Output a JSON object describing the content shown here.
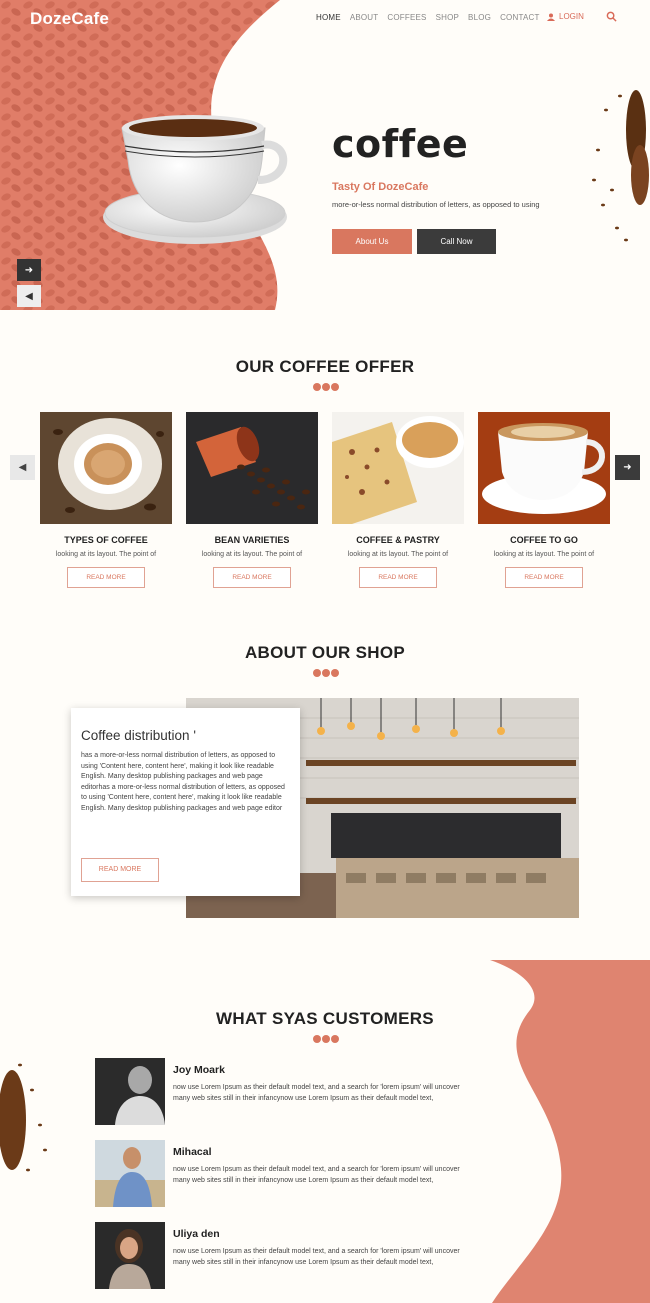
{
  "header": {
    "logo_part1": "Doze",
    "logo_part2": "Cafe",
    "nav": [
      "HOME",
      "ABOUT",
      "COFFEES",
      "SHOP",
      "BLOG",
      "CONTACT"
    ],
    "login_label": "LOGIN"
  },
  "hero": {
    "title": "coffee",
    "subtitle": "Tasty Of DozeCafe",
    "description": "more-or-less normal distribution of letters, as opposed to using",
    "about_button": "About Us",
    "call_button": "Call Now"
  },
  "offer": {
    "title": "OUR COFFEE OFFER",
    "items": [
      {
        "name": "TYPES OF COFFEE",
        "desc": "looking at its layout. The point of",
        "button": "READ MORE"
      },
      {
        "name": "BEAN VARIETIES",
        "desc": "looking at its layout. The point of",
        "button": "READ MORE"
      },
      {
        "name": "COFFEE & PASTRY",
        "desc": "looking at its layout. The point of",
        "button": "READ MORE"
      },
      {
        "name": "COFFEE TO GO",
        "desc": "looking at its layout. The point of",
        "button": "READ MORE"
      }
    ]
  },
  "about": {
    "title": "ABOUT OUR SHOP",
    "heading": "Coffee distribution '",
    "text": "has a more-or-less normal distribution of letters, as opposed to using 'Content here, content here', making it look like readable English. Many desktop publishing packages and web page editorhas a more-or-less normal distribution of letters, as opposed to using 'Content here, content here', making it look like readable English. Many desktop publishing packages and web page editor",
    "button": "READ MORE"
  },
  "customers": {
    "title": "WHAT SYAS CUSTOMERS",
    "items": [
      {
        "name": "Joy Moark",
        "text": "now use Lorem Ipsum as their default model text, and a search for 'lorem ipsum' will uncover many web sites still in their infancynow use Lorem Ipsum as their default model text,"
      },
      {
        "name": "Mihacal",
        "text": "now use Lorem Ipsum as their default model text, and a search for 'lorem ipsum' will uncover many web sites still in their infancynow use Lorem Ipsum as their default model text,"
      },
      {
        "name": "Uliya den",
        "text": "now use Lorem Ipsum as their default model text, and a search for 'lorem ipsum' will uncover many web sites still in their infancynow use Lorem Ipsum as their default model text,"
      }
    ]
  },
  "colors": {
    "accent": "#d9775f",
    "dark": "#3b3b3b",
    "background": "#fffdf9"
  }
}
